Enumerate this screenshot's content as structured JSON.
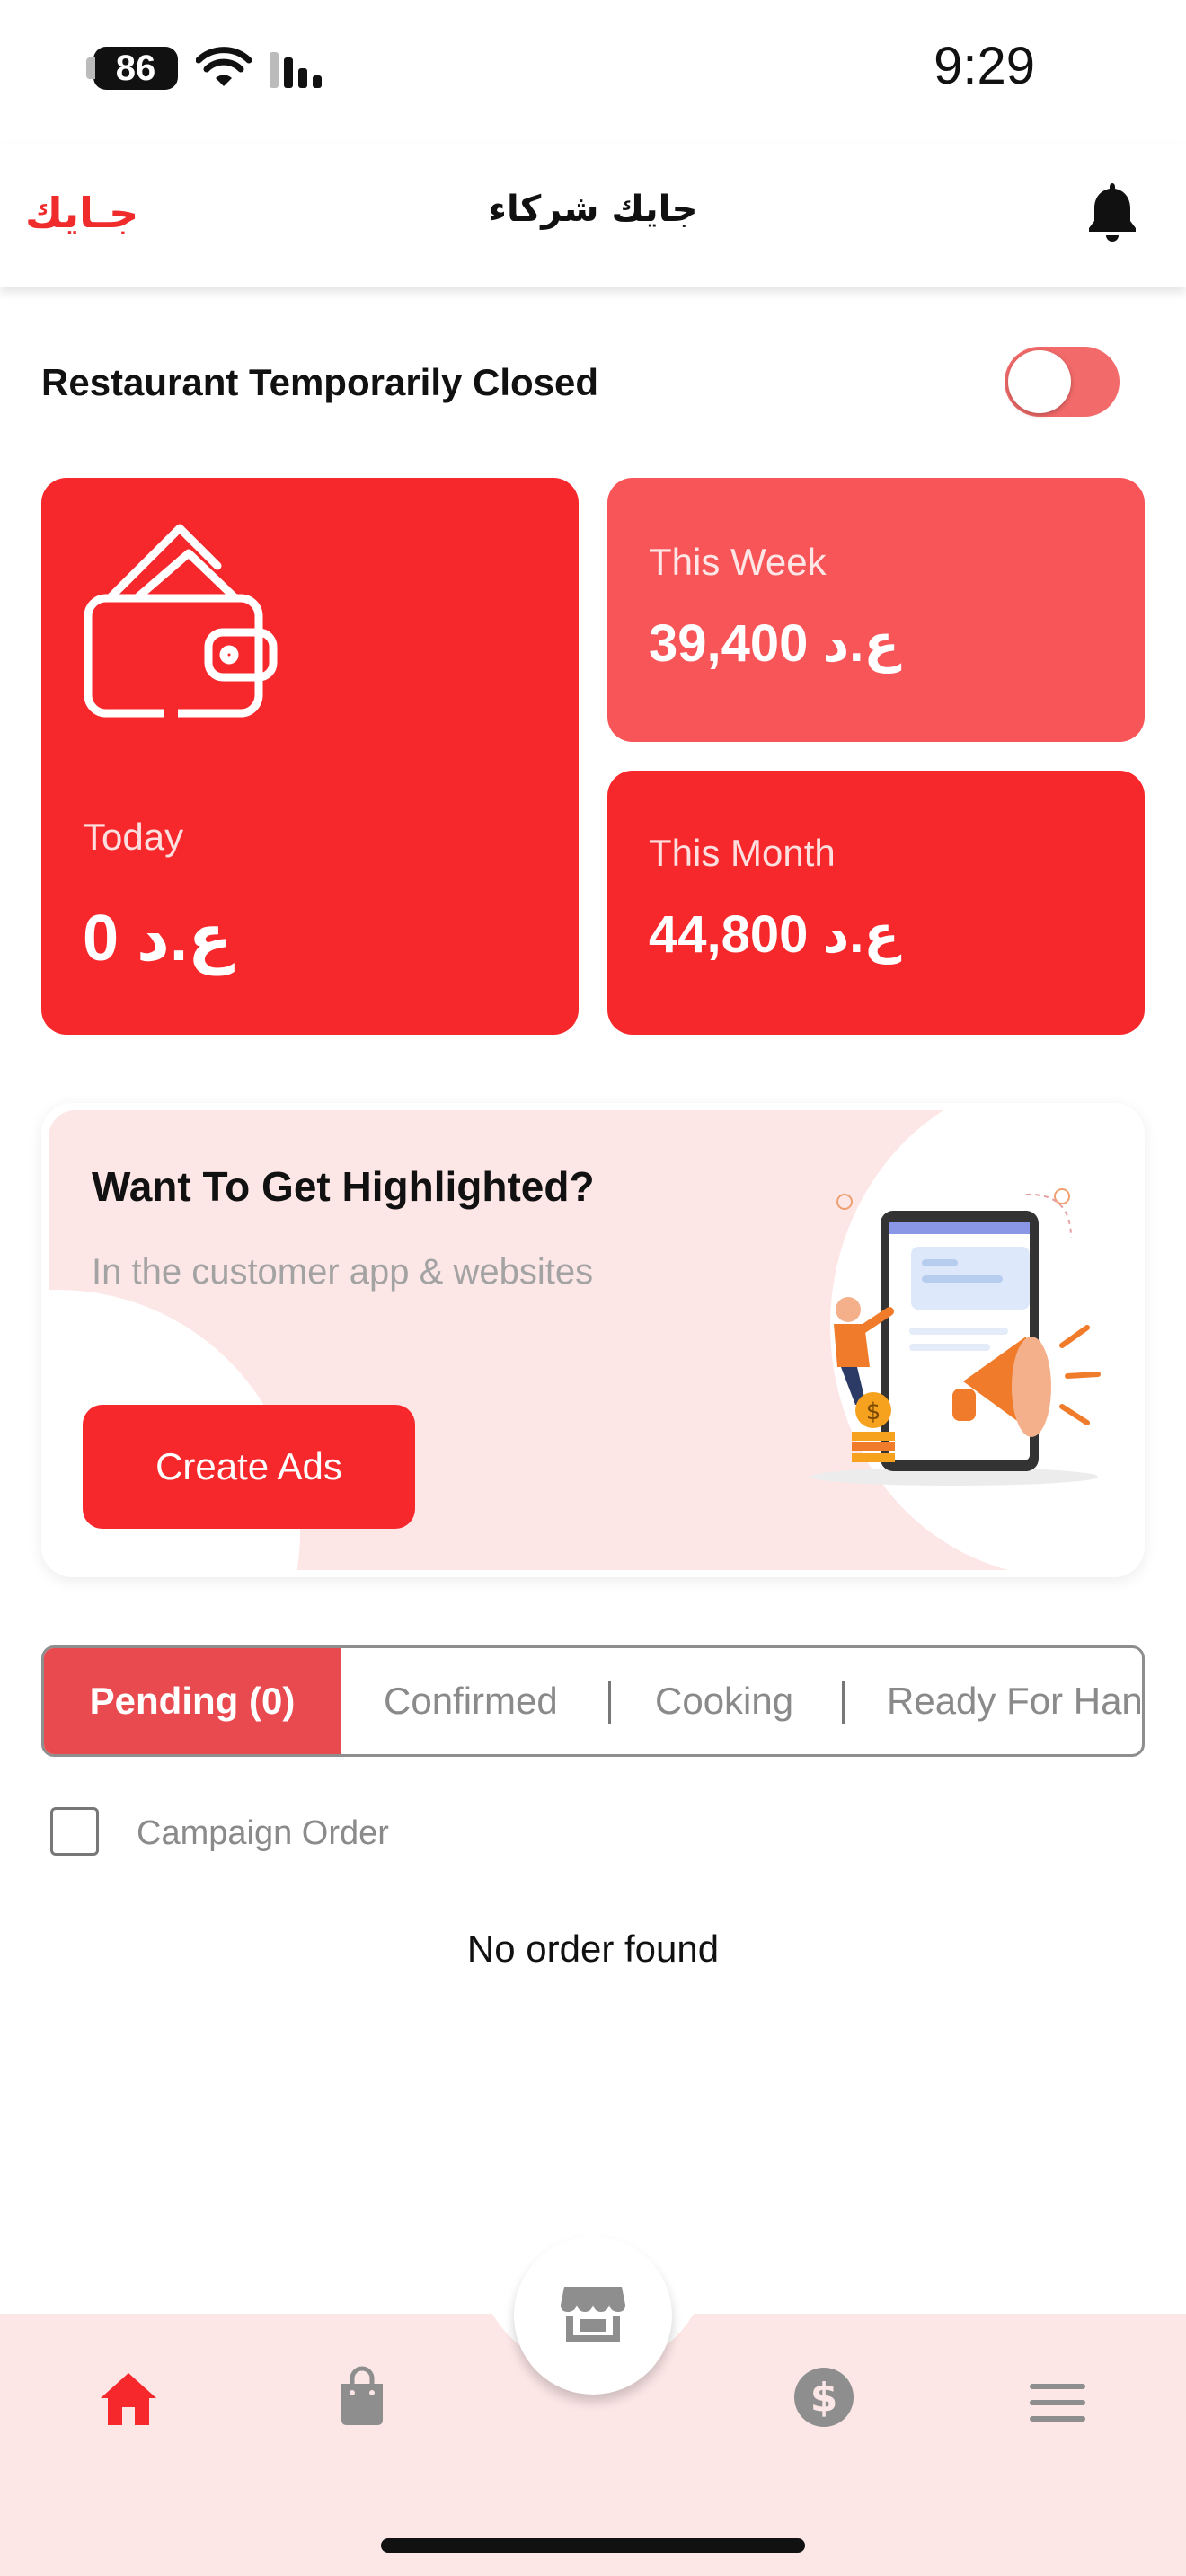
{
  "status_bar": {
    "battery": "86",
    "time": "9:29"
  },
  "header": {
    "brand": "جـايك",
    "title": "جايك شركاء",
    "icons": {
      "notifications": "bell-icon"
    }
  },
  "restaurant_status": {
    "label": "Restaurant Temporarily Closed",
    "closed": false
  },
  "earnings": {
    "today": {
      "label": "Today",
      "value": "0 ع.د"
    },
    "this_week": {
      "label": "This Week",
      "value": "39,400 ع.د"
    },
    "this_month": {
      "label": "This Month",
      "value": "44,800 ع.د"
    }
  },
  "promo": {
    "title": "Want To Get Highlighted?",
    "subtitle": "In the customer app & websites",
    "button_label": "Create Ads"
  },
  "order_tabs": {
    "pending": "Pending (0)",
    "confirmed": "Confirmed",
    "cooking": "Cooking",
    "ready": "Ready For Han"
  },
  "campaign_filter": {
    "label": "Campaign Order",
    "checked": false
  },
  "empty_state": "No order found",
  "bottom_nav": {
    "items": [
      "home-icon",
      "shopping-bag-icon",
      "store-icon",
      "dollar-icon",
      "menu-icon"
    ],
    "active": "home-icon"
  },
  "colors": {
    "accent": "#f7282c",
    "accent_light": "#f75558",
    "tab_active": "#e84a4f",
    "nav_bg": "#fce6e6",
    "muted": "#8a8a8a"
  }
}
